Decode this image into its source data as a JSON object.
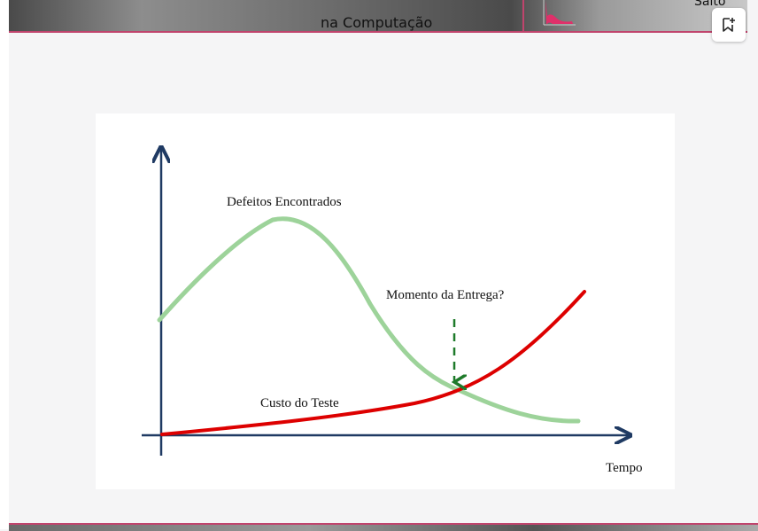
{
  "header": {
    "title": "na Computação",
    "right_text": "Salto"
  },
  "toolbar": {
    "bookmark_icon": "bookmark-add-icon"
  },
  "diagram": {
    "labels": {
      "defects": "Defeitos Encontrados",
      "delivery": "Momento da Entrega?",
      "cost": "Custo do Teste",
      "time_axis": "Tempo"
    },
    "colors": {
      "defects_curve": "#9dd39a",
      "cost_curve": "#dd0000",
      "axes": "#1f3a63",
      "delivery_arrow": "#1e7a2a"
    }
  }
}
